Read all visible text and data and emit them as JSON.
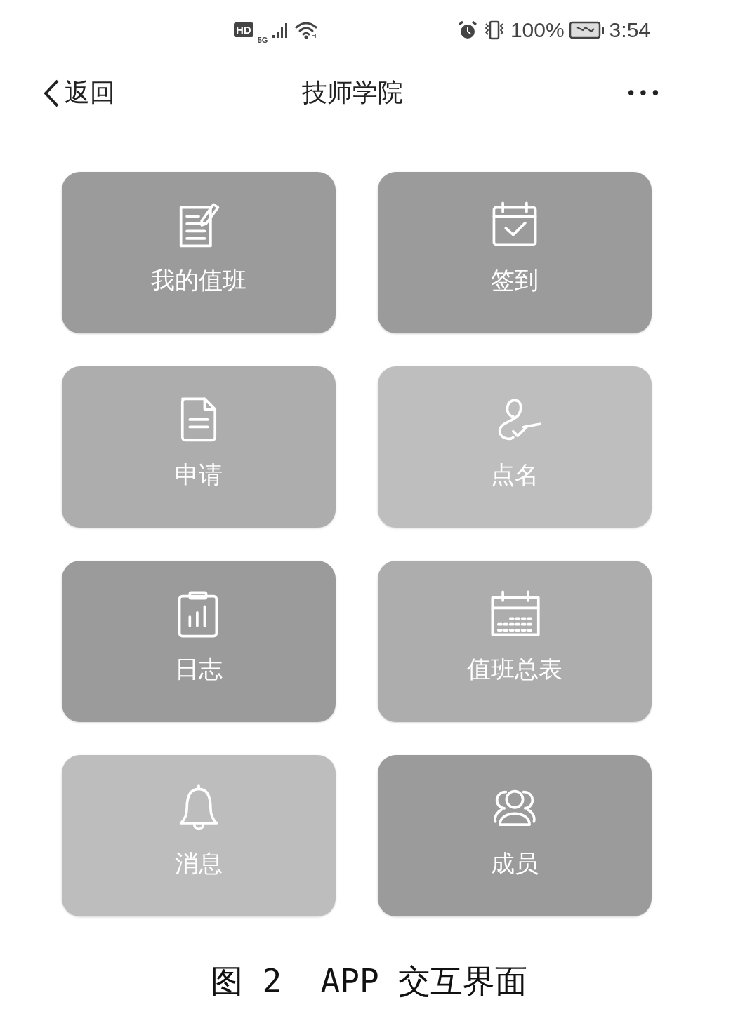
{
  "status_bar": {
    "hd": "HD",
    "network": "5G",
    "battery": "100%",
    "time": "3:54"
  },
  "nav_bar": {
    "back": "返回",
    "title": "技师学院",
    "more": "•••"
  },
  "tiles": [
    {
      "label": "我的值班",
      "kind": "edit",
      "color": "#9b9b9b"
    },
    {
      "label": "签到",
      "kind": "check-calendar",
      "color": "#9b9b9b"
    },
    {
      "label": "申请",
      "kind": "document",
      "color": "#adadad"
    },
    {
      "label": "点名",
      "kind": "roll-call",
      "color": "#bebebe"
    },
    {
      "label": "日志",
      "kind": "report",
      "color": "#9b9b9b"
    },
    {
      "label": "值班总表",
      "kind": "calendar",
      "color": "#adadad"
    },
    {
      "label": "消息",
      "kind": "bell",
      "color": "#bdbdbd"
    },
    {
      "label": "成员",
      "kind": "group",
      "color": "#9b9b9b"
    }
  ],
  "caption": "图 2  APP 交互界面"
}
